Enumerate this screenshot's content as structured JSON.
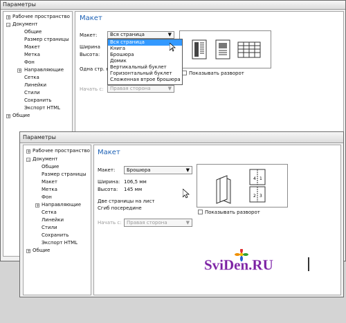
{
  "back_window": {
    "title": "Параметры",
    "tree": {
      "workspace": "Рабочее пространство",
      "document": "Документ",
      "general_item": "Общие",
      "page_size": "Размер страницы",
      "layout": "Макет",
      "label": "Метка",
      "background": "Фон",
      "guides": "Направляющие",
      "grid": "Сетка",
      "rulers": "Линейки",
      "styles": "Стили",
      "save": "Сохранить",
      "export_html": "Экспорт HTML",
      "general_root": "Общие"
    },
    "panel": {
      "heading": "Макет",
      "layout_label": "Макет:",
      "layout_value": "Вся страница",
      "width_label": "Ширина",
      "height_label": "Высота:",
      "pages_per_sheet": "Одна стр. н",
      "start_label": "Начать с:",
      "start_value": "Правая сторона",
      "show_spread": "Показывать разворот"
    },
    "dropdown_options": [
      "Вся страница",
      "Книга",
      "Брошюра",
      "Домик",
      "Вертикальный буклет",
      "Горизонтальный буклет",
      "Сложенная втрое брошюра"
    ]
  },
  "front_window": {
    "title": "Параметры",
    "tree": {
      "workspace": "Рабочее пространство",
      "document": "Документ",
      "general_item": "Общие",
      "page_size": "Размер страницы",
      "layout": "Макет",
      "label": "Метка",
      "background": "Фон",
      "guides": "Направляющие",
      "grid": "Сетка",
      "rulers": "Линейки",
      "styles": "Стили",
      "save": "Сохранить",
      "export_html": "Экспорт HTML",
      "general_root": "Общие"
    },
    "panel": {
      "heading": "Макет",
      "layout_label": "Макет:",
      "layout_value": "Брошюра",
      "width_label": "Ширина:",
      "width_value": "106,5 мм",
      "height_label": "Высота:",
      "height_value": "145 мм",
      "pages_per_sheet": "Две страницы на лист",
      "fold": "Сгиб посередине",
      "start_label": "Начать с:",
      "start_value": "Правая сторона",
      "show_spread": "Показывать разворот"
    }
  },
  "watermark": {
    "brand": "SviDen.RU"
  },
  "colors": {
    "accent_heading": "#1a5fb4",
    "selection": "#3399ff",
    "watermark": "#7a1fa0"
  }
}
